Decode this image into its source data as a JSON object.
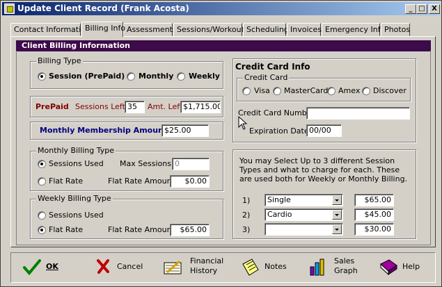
{
  "window": {
    "title": "Update Client Record  (Frank Acosta)",
    "min_glyph": "_",
    "max_glyph": "□",
    "close_glyph": "X"
  },
  "tabs": [
    {
      "label": "Contact Information",
      "active": false
    },
    {
      "label": "Billing Info",
      "active": true
    },
    {
      "label": "Assessments",
      "active": false
    },
    {
      "label": "Sessions/Workouts",
      "active": false
    },
    {
      "label": "Scheduling",
      "active": false
    },
    {
      "label": "Invoices",
      "active": false
    },
    {
      "label": "Emergency Info",
      "active": false
    },
    {
      "label": "Photos",
      "active": false
    }
  ],
  "panel": {
    "header": "Client Billing Information"
  },
  "billing_type": {
    "legend": "Billing Type",
    "options": {
      "session": "Session (PrePaid)",
      "monthly": "Monthly",
      "weekly": "Weekly"
    },
    "selected": "session"
  },
  "prepaid": {
    "label": "PrePaid",
    "sessions_left_label": "Sessions Left:",
    "sessions_left": "35",
    "amt_left_label": "Amt. Left:",
    "amt_left": "$1,715.00"
  },
  "monthly_membership": {
    "label": "Monthly Membership Amount:",
    "value": "$25.00"
  },
  "monthly_billing": {
    "legend": "Monthly Billing Type",
    "sessions_used_label": "Sessions Used",
    "flat_rate_label": "Flat Rate",
    "max_sessions_label": "Max Sessions:",
    "max_sessions": "0",
    "flat_rate_amount_label": "Flat Rate Amount:",
    "flat_rate_amount": "$0.00",
    "selected": "sessions_used"
  },
  "weekly_billing": {
    "legend": "Weekly Billing Type",
    "sessions_used_label": "Sessions Used",
    "flat_rate_label": "Flat Rate",
    "flat_rate_amount_label": "Flat Rate Amount:",
    "flat_rate_amount": "$65.00",
    "selected": "flat_rate"
  },
  "credit_card": {
    "title": "Credit Card Info",
    "legend": "Credit Card",
    "options": [
      "Visa",
      "MasterCard",
      "Amex",
      "Discover"
    ],
    "number_label": "Credit Card Number:",
    "number": "",
    "expiration_label": "Expiration Date:",
    "expiration": "00/00"
  },
  "session_types": {
    "description": "You may Select Up to 3 different Session Types and what to charge for each. These are used both for Weekly or Monthly Billing.",
    "rows": [
      {
        "num": "1)",
        "type": "Single",
        "amount": "$65.00"
      },
      {
        "num": "2)",
        "type": "Cardio",
        "amount": "$45.00"
      },
      {
        "num": "3)",
        "type": "",
        "amount": "$30.00"
      }
    ]
  },
  "bottom_buttons": {
    "ok": "OK",
    "cancel": "Cancel",
    "financial_1": "Financial",
    "financial_2": "History",
    "notes": "Notes",
    "sales_1": "Sales",
    "sales_2": "Graph",
    "help": "Help"
  },
  "icons": [
    "check-icon",
    "cancel-x-icon",
    "financial-history-icon",
    "notes-icon",
    "sales-graph-icon",
    "help-book-icon"
  ],
  "colors": {
    "title_start": "#0a246a",
    "title_end": "#a6caf0",
    "panel_header": "#3d0a4a",
    "prepaid_label": "#800000",
    "membership_label": "#000080"
  }
}
